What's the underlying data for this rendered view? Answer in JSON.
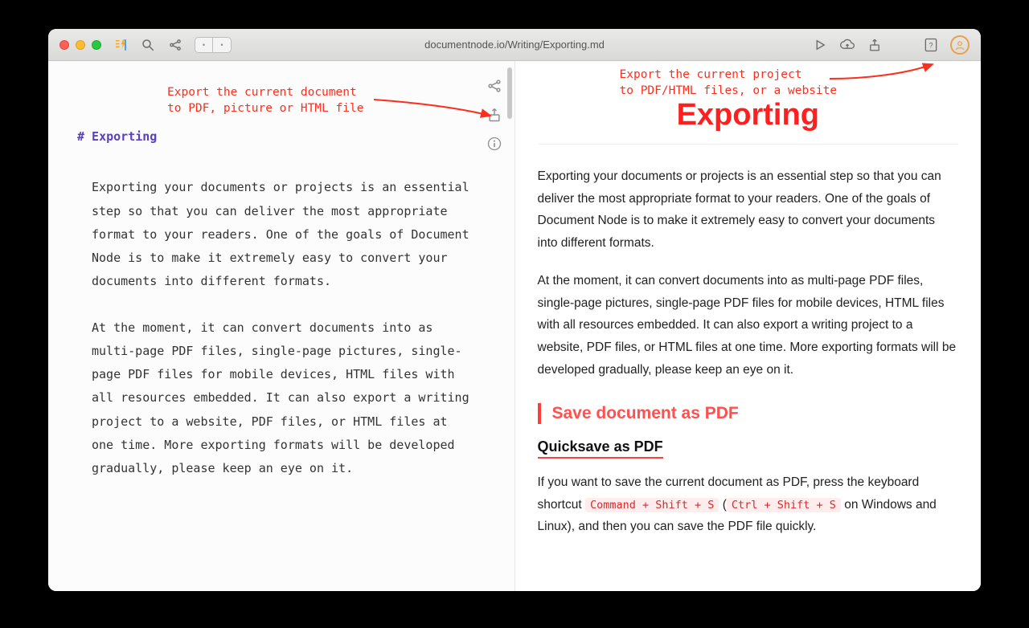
{
  "window": {
    "title": "documentnode.io/Writing/Exporting.md"
  },
  "annotations": {
    "left": "Export the current document\nto PDF, picture or HTML file",
    "right": "Export the current project\nto PDF/HTML files, or a website"
  },
  "editor": {
    "heading": "# Exporting",
    "para1": "Exporting your documents or projects is an essential step so that you can deliver the most appropriate format to your readers. One of the goals of Document Node is to make it extremely easy to convert your documents into different formats.",
    "para2": "At the moment, it can convert documents into as multi-page PDF files, single-page pictures, single-page PDF files for mobile devices, HTML files with all resources embedded. It can also export a writing project to a website, PDF files, or HTML files at one time. More exporting formats will be developed gradually, please keep an eye on it."
  },
  "preview": {
    "title": "Exporting",
    "para1": "Exporting your documents or projects is an essential step so that you can deliver the most appropriate format to your readers. One of the goals of Document Node is to make it extremely easy to convert your documents into different formats.",
    "para2": "At the moment, it can convert documents into as multi-page PDF files, single-page pictures, single-page PDF files for mobile devices, HTML files with all resources embedded. It can also export a writing project to a website, PDF files, or HTML files at one time. More exporting formats will be developed gradually, please keep an eye on it.",
    "h2": "Save document as PDF",
    "h3": "Quicksave as PDF",
    "qs_pre": "If you want to save the current document as PDF, press the keyboard shortcut ",
    "kbd1": "Command + Shift + S",
    "qs_mid": " (",
    "kbd2": "Ctrl + Shift + S",
    "qs_post": " on Windows and Linux), and then you can save the PDF file quickly."
  }
}
